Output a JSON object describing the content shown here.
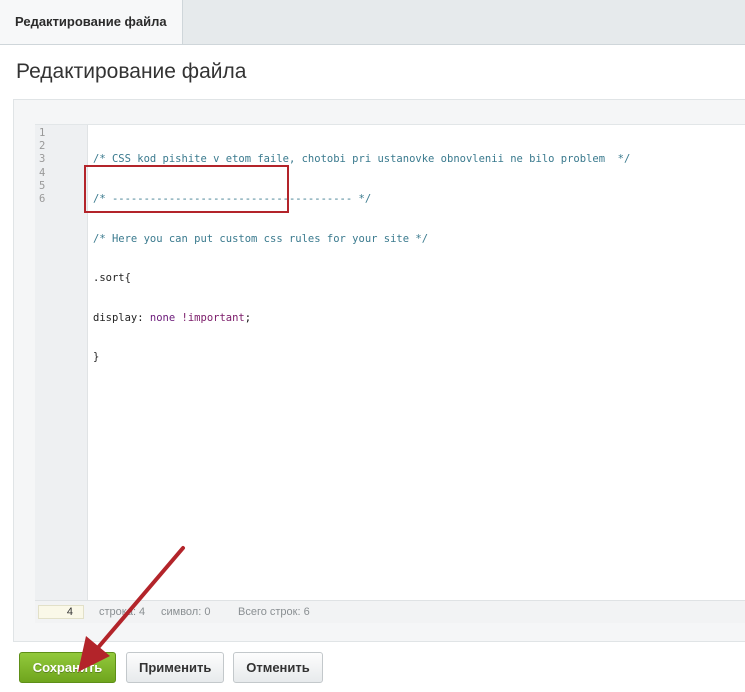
{
  "tab": {
    "label": "Редактирование файла"
  },
  "page": {
    "title": "Редактирование файла"
  },
  "editor": {
    "line_numbers": [
      "1",
      "2",
      "3",
      "4",
      "5",
      "6"
    ],
    "lines": [
      "/* CSS kod pishite v etom faile, chotobi pri ustanovke obnovlenii ne bilo problem  */",
      "/* -------------------------------------- */",
      "/* Here you can put custom css rules for your site */",
      ".sort{",
      "display: none !important;",
      "}"
    ],
    "tokens": {
      "prop": "display:",
      "value": "none",
      "important": "!important",
      "semicolon": ";"
    }
  },
  "status": {
    "current_line": "4",
    "line_label": "строка: 4",
    "symbol_label": "символ: 0",
    "total_label": "Всего строк: 6"
  },
  "buttons": {
    "save": "Сохранить",
    "apply": "Применить",
    "cancel": "Отменить"
  },
  "colors": {
    "highlight": "#b3242a",
    "save_green": "#7ab32a",
    "arrow": "#b3242a"
  }
}
